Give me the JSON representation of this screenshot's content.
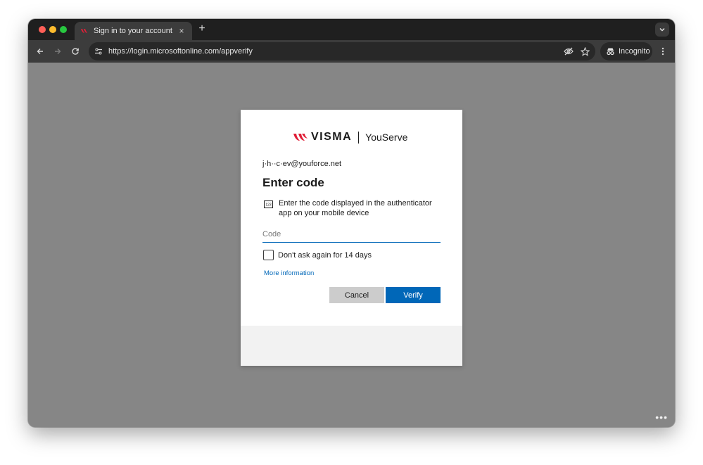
{
  "browser": {
    "tab_title": "Sign in to your account",
    "tab_close_glyph": "×",
    "new_tab_glyph": "+",
    "url": "https://login.microsoftonline.com/appverify",
    "incognito_label": "Incognito",
    "corner_glyph": "•••"
  },
  "signin": {
    "brand": "VISMA",
    "brand_sub": "YouServe",
    "email": "j·h··c·ev@youforce.net",
    "heading": "Enter code",
    "description": "Enter the code displayed in the authenticator app on your mobile device",
    "code_placeholder": "Code",
    "remember_label": "Don't ask again for 14 days",
    "remember_checked": false,
    "more_info_link": "More information",
    "cancel_label": "Cancel",
    "verify_label": "Verify"
  },
  "colors": {
    "accent": "#0067b8",
    "visma_red": "#e01e37",
    "page_backdrop": "#868686",
    "footer": "#f2f2f2"
  }
}
